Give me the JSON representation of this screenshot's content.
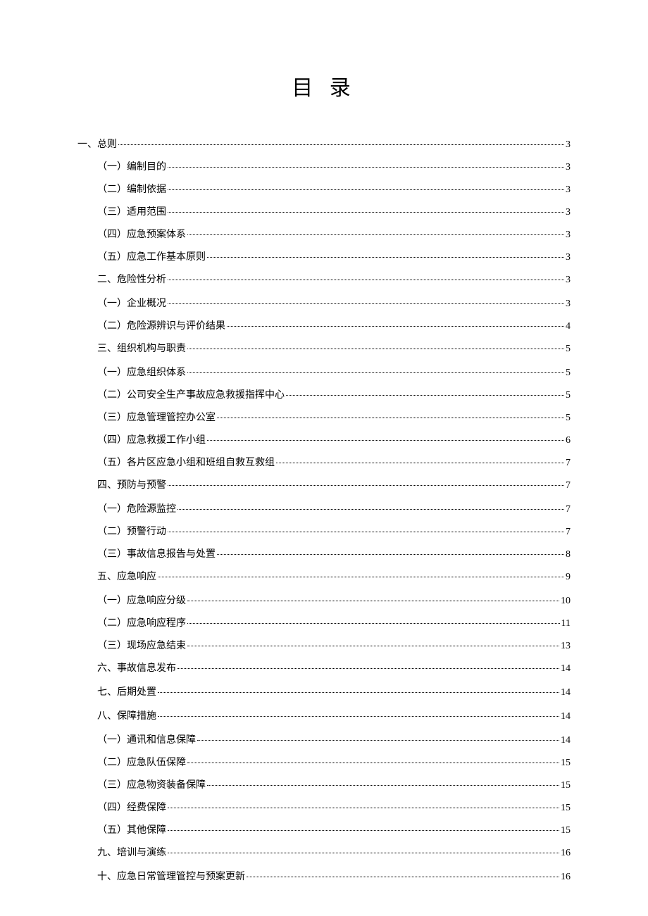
{
  "title": "目 录",
  "entries": [
    {
      "level": "level1",
      "label": "一、总则",
      "page": "3"
    },
    {
      "level": "level2",
      "label": "（一）编制目的",
      "page": "3"
    },
    {
      "level": "level2",
      "label": "（二）编制依据",
      "page": "3"
    },
    {
      "level": "level2",
      "label": "（三）适用范围",
      "page": "3"
    },
    {
      "level": "level2",
      "label": "（四）应急预案体系",
      "page": "3"
    },
    {
      "level": "level2",
      "label": "（五）应急工作基本原则",
      "page": "3"
    },
    {
      "level": "section",
      "label": "二、危险性分析",
      "page": "3"
    },
    {
      "level": "level2",
      "label": "（一）企业概况",
      "page": "3"
    },
    {
      "level": "level2",
      "label": "（二）危险源辨识与评价结果",
      "page": "4"
    },
    {
      "level": "section",
      "label": "三、组织机构与职责",
      "page": "5"
    },
    {
      "level": "level2",
      "label": "（一）应急组织体系",
      "page": "5"
    },
    {
      "level": "level2",
      "label": "（二）公司安全生产事故应急救援指挥中心",
      "page": "5"
    },
    {
      "level": "level2",
      "label": "（三）应急管理管控办公室",
      "page": "5"
    },
    {
      "level": "level2",
      "label": "（四）应急救援工作小组",
      "page": "6"
    },
    {
      "level": "level2",
      "label": "（五）各片区应急小组和班组自救互救组",
      "page": "7"
    },
    {
      "level": "section",
      "label": "四、预防与预警",
      "page": "7"
    },
    {
      "level": "level2",
      "label": "（一）危险源监控",
      "page": "7"
    },
    {
      "level": "level2",
      "label": "（二）预警行动",
      "page": "7"
    },
    {
      "level": "level2",
      "label": "（三）事故信息报告与处置",
      "page": "8"
    },
    {
      "level": "section",
      "label": "五、应急响应",
      "page": "9"
    },
    {
      "level": "level2",
      "label": "（一）应急响应分级",
      "page": "10"
    },
    {
      "level": "level2",
      "label": "（二）应急响应程序",
      "page": "11"
    },
    {
      "level": "level2",
      "label": "（三）现场应急结束",
      "page": "13"
    },
    {
      "level": "section",
      "label": "六、事故信息发布",
      "page": "14"
    },
    {
      "level": "section",
      "label": "七、后期处置",
      "page": "14"
    },
    {
      "level": "section",
      "label": "八、保障措施",
      "page": "14"
    },
    {
      "level": "level2",
      "label": "（一）通讯和信息保障",
      "page": "14"
    },
    {
      "level": "level2",
      "label": "（二）应急队伍保障",
      "page": "15"
    },
    {
      "level": "level2",
      "label": "（三）应急物资装备保障",
      "page": "15"
    },
    {
      "level": "level2",
      "label": "（四）经费保障",
      "page": "15"
    },
    {
      "level": "level2",
      "label": "（五）其他保障",
      "page": "15"
    },
    {
      "level": "section",
      "label": "九、培训与演练",
      "page": "16"
    },
    {
      "level": "section",
      "label": "十、应急日常管理管控与预案更新",
      "page": "16"
    }
  ]
}
